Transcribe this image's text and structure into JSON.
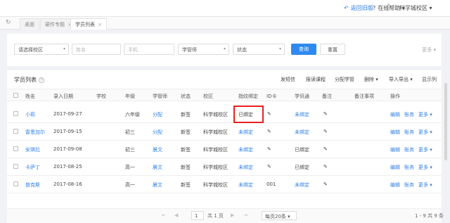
{
  "topbar": {
    "back_label": "返回旧版",
    "help_label": "在线帮助",
    "campus_label": "科学城校区"
  },
  "tabs": [
    {
      "label": "桌面"
    },
    {
      "label": "硬件专题"
    },
    {
      "label": "学员列表"
    }
  ],
  "filters": {
    "campus_select": "请选择校区",
    "name_placeholder": "姓名",
    "phone_placeholder": "手机",
    "manager_select": "学管师",
    "status_select": "状态",
    "search_label": "查询",
    "reset_label": "重置",
    "more_label": "更多"
  },
  "list": {
    "title": "学员列表",
    "actions": {
      "send_sms": "发短信",
      "enroll": "报读课程",
      "assign_manager": "分配学管",
      "delete": "删除",
      "import_export": "导入导出",
      "show_columns": "显示列"
    },
    "columns": [
      "姓名",
      "录入日期",
      "学校",
      "年级",
      "学管师",
      "状态",
      "校区",
      "指纹绑定",
      "ID卡",
      "学讯通",
      "备注",
      "备注事项",
      "操作"
    ],
    "rows": [
      {
        "name": "小莉",
        "date": "2017-09-27",
        "school": "",
        "grade": "六年级",
        "manager": "分配",
        "status": "新签",
        "campus": "科学城校区",
        "fingerprint": "已绑定",
        "idcard": "",
        "xuexuntong": "未绑定",
        "remark": ""
      },
      {
        "name": "雷恩加尔",
        "date": "2017-09-15",
        "school": "",
        "grade": "初三",
        "manager": "分配",
        "status": "新签",
        "campus": "科学城校区",
        "fingerprint": "未绑定",
        "idcard": "",
        "xuexuntong": "未绑定",
        "remark": ""
      },
      {
        "name": "安琪拉",
        "date": "2017-09-08",
        "school": "",
        "grade": "初三",
        "manager": "晨文",
        "status": "新签",
        "campus": "科学城校区",
        "fingerprint": "未绑定",
        "idcard": "",
        "xuexuntong": "已绑定",
        "remark": ""
      },
      {
        "name": "卡萨丁",
        "date": "2017-08-25",
        "school": "",
        "grade": "高一",
        "manager": "晨文",
        "status": "新签",
        "campus": "科学城校区",
        "fingerprint": "未绑定",
        "idcard": "",
        "xuexuntong": "已绑定",
        "remark": ""
      },
      {
        "name": "普克斯",
        "date": "2017-08-16",
        "school": "",
        "grade": "高一",
        "manager": "晨文",
        "status": "新签",
        "campus": "科学城校区",
        "fingerprint": "未绑定",
        "idcard": "001",
        "xuexuntong": "未绑定",
        "remark": ""
      }
    ],
    "row_actions": {
      "edit": "编辑",
      "account": "账务",
      "more": "更多"
    }
  },
  "pager": {
    "page_input": "1",
    "total_pages": "共 1 页",
    "page_size": "每页20条",
    "summary": "1 - 9 共 9 条"
  }
}
